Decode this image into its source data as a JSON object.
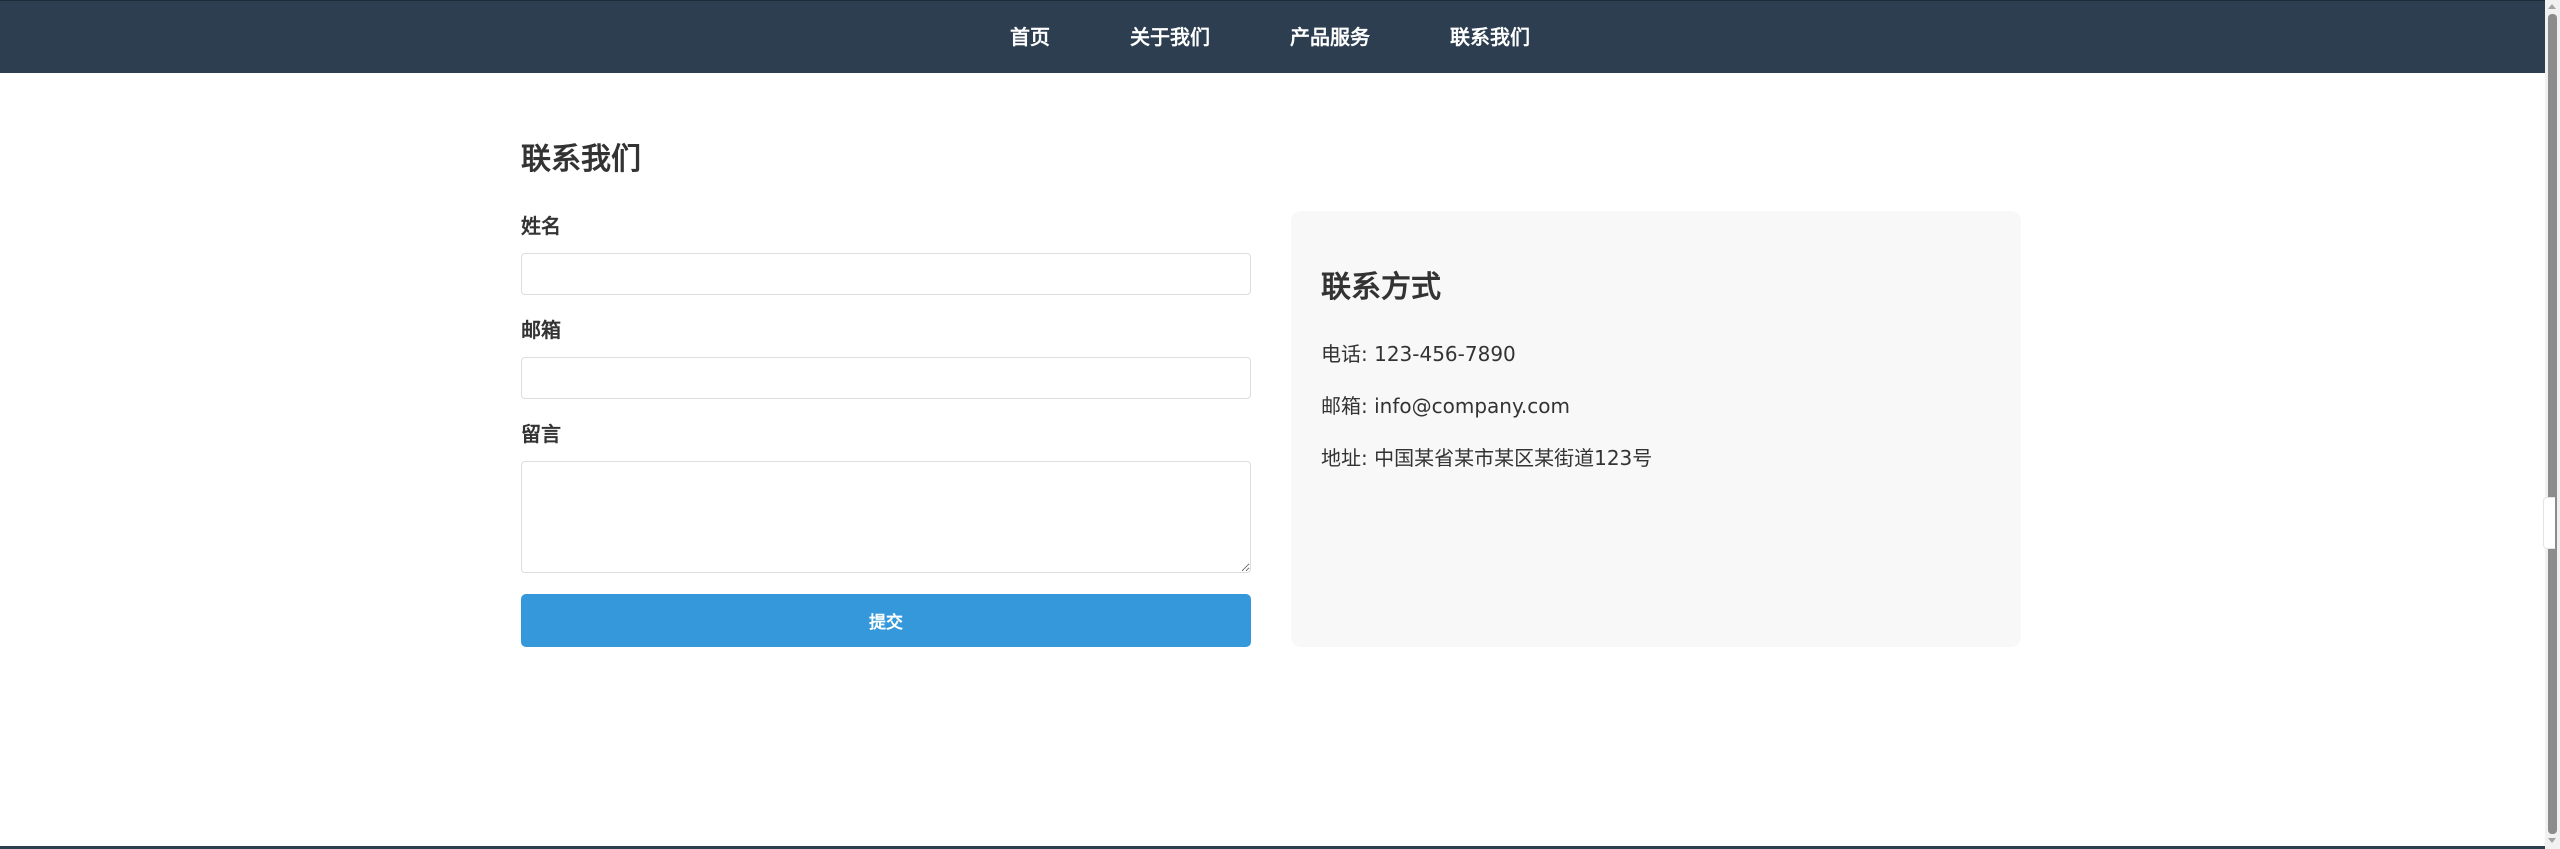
{
  "nav": {
    "items": [
      {
        "label": "首页"
      },
      {
        "label": "关于我们"
      },
      {
        "label": "产品服务"
      },
      {
        "label": "联系我们"
      }
    ]
  },
  "contact_form": {
    "title": "联系我们",
    "name_label": "姓名",
    "name_value": "",
    "email_label": "邮箱",
    "email_value": "",
    "message_label": "留言",
    "message_value": "",
    "submit_label": "提交"
  },
  "contact_info": {
    "title": "联系方式",
    "phone": "电话: 123-456-7890",
    "email": "邮箱: info@company.com",
    "address": "地址: 中国某省某市某区某街道123号"
  },
  "colors": {
    "nav_background": "#2c3e50",
    "primary_button": "#3498db",
    "card_background": "#f8f8f8"
  }
}
